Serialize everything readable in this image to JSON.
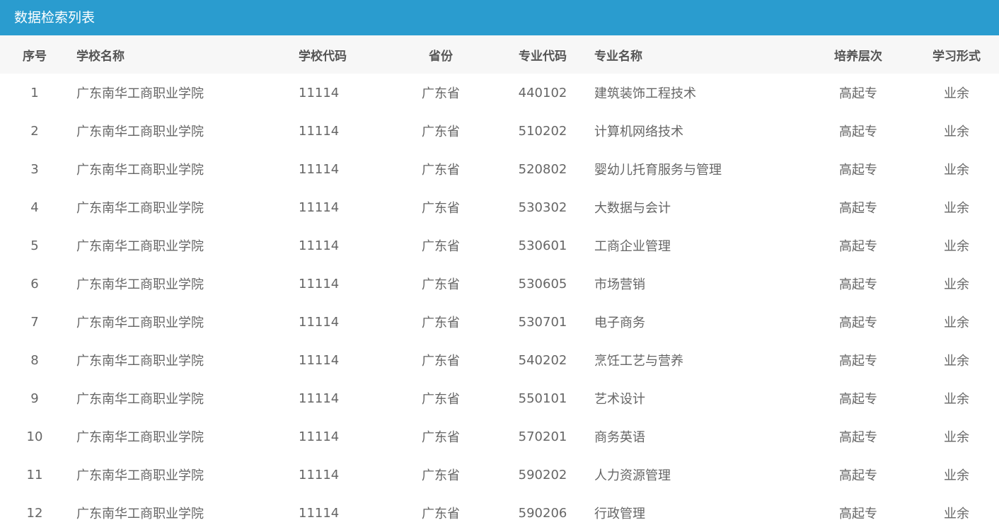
{
  "panel": {
    "title": "数据检索列表"
  },
  "colors": {
    "header_bg": "#2a9ccf",
    "table_head_bg": "#f7f7f7"
  },
  "table": {
    "columns": [
      "序号",
      "学校名称",
      "学校代码",
      "省份",
      "专业代码",
      "专业名称",
      "培养层次",
      "学习形式"
    ],
    "rows": [
      [
        "1",
        "广东南华工商职业学院",
        "11114",
        "广东省",
        "440102",
        "建筑装饰工程技术",
        "高起专",
        "业余"
      ],
      [
        "2",
        "广东南华工商职业学院",
        "11114",
        "广东省",
        "510202",
        "计算机网络技术",
        "高起专",
        "业余"
      ],
      [
        "3",
        "广东南华工商职业学院",
        "11114",
        "广东省",
        "520802",
        "婴幼儿托育服务与管理",
        "高起专",
        "业余"
      ],
      [
        "4",
        "广东南华工商职业学院",
        "11114",
        "广东省",
        "530302",
        "大数据与会计",
        "高起专",
        "业余"
      ],
      [
        "5",
        "广东南华工商职业学院",
        "11114",
        "广东省",
        "530601",
        "工商企业管理",
        "高起专",
        "业余"
      ],
      [
        "6",
        "广东南华工商职业学院",
        "11114",
        "广东省",
        "530605",
        "市场营销",
        "高起专",
        "业余"
      ],
      [
        "7",
        "广东南华工商职业学院",
        "11114",
        "广东省",
        "530701",
        "电子商务",
        "高起专",
        "业余"
      ],
      [
        "8",
        "广东南华工商职业学院",
        "11114",
        "广东省",
        "540202",
        "烹饪工艺与营养",
        "高起专",
        "业余"
      ],
      [
        "9",
        "广东南华工商职业学院",
        "11114",
        "广东省",
        "550101",
        "艺术设计",
        "高起专",
        "业余"
      ],
      [
        "10",
        "广东南华工商职业学院",
        "11114",
        "广东省",
        "570201",
        "商务英语",
        "高起专",
        "业余"
      ],
      [
        "11",
        "广东南华工商职业学院",
        "11114",
        "广东省",
        "590202",
        "人力资源管理",
        "高起专",
        "业余"
      ],
      [
        "12",
        "广东南华工商职业学院",
        "11114",
        "广东省",
        "590206",
        "行政管理",
        "高起专",
        "业余"
      ]
    ]
  }
}
